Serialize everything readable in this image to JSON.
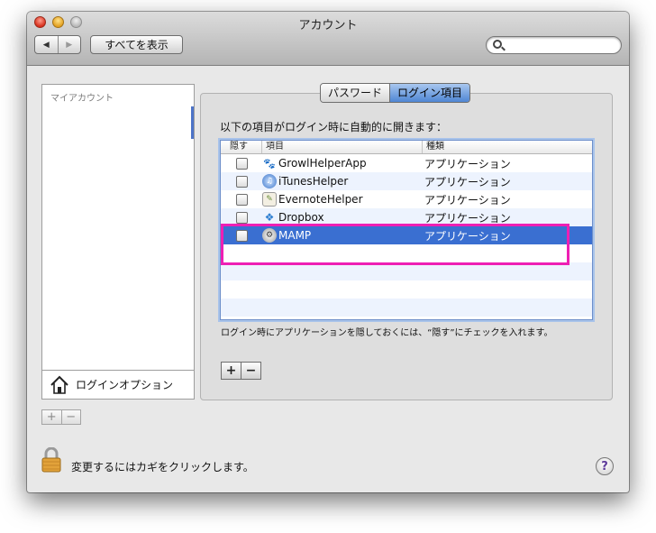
{
  "window": {
    "title": "アカウント"
  },
  "toolbar": {
    "back_icon": "◀",
    "forward_icon": "▶",
    "show_all_label": "すべてを表示",
    "search_placeholder": ""
  },
  "sidebar": {
    "header": "マイアカウント",
    "login_options_label": "ログインオプション",
    "add_label": "+",
    "remove_label": "−"
  },
  "tabs": [
    {
      "label": "パスワード",
      "active": false
    },
    {
      "label": "ログイン項目",
      "active": true
    }
  ],
  "login_items": {
    "description": "以下の項目がログイン時に自動的に開きます：",
    "columns": {
      "hide": "隠す",
      "item": "項目",
      "kind": "種類"
    },
    "rows": [
      {
        "name": "GrowlHelperApp",
        "kind": "アプリケーション",
        "icon": "growl-icon",
        "hidden": false,
        "selected": false
      },
      {
        "name": "iTunesHelper",
        "kind": "アプリケーション",
        "icon": "itunes-icon",
        "hidden": false,
        "selected": false
      },
      {
        "name": "EvernoteHelper",
        "kind": "アプリケーション",
        "icon": "evernote-icon",
        "hidden": false,
        "selected": false
      },
      {
        "name": "Dropbox",
        "kind": "アプリケーション",
        "icon": "dropbox-icon",
        "hidden": false,
        "selected": false
      },
      {
        "name": "MAMP",
        "kind": "アプリケーション",
        "icon": "mamp-icon",
        "hidden": false,
        "selected": true
      }
    ],
    "hint": "ログイン時にアプリケーションを隠しておくには、“隠す”にチェックを入れます。",
    "add_label": "+",
    "remove_label": "−"
  },
  "footer": {
    "lock_text": "変更するにはカギをクリックします。",
    "help_label": "?"
  },
  "colors": {
    "selection": "#3a6fd1",
    "highlight_annotation": "#ee1fb4",
    "active_tab": "#4f86d4"
  }
}
